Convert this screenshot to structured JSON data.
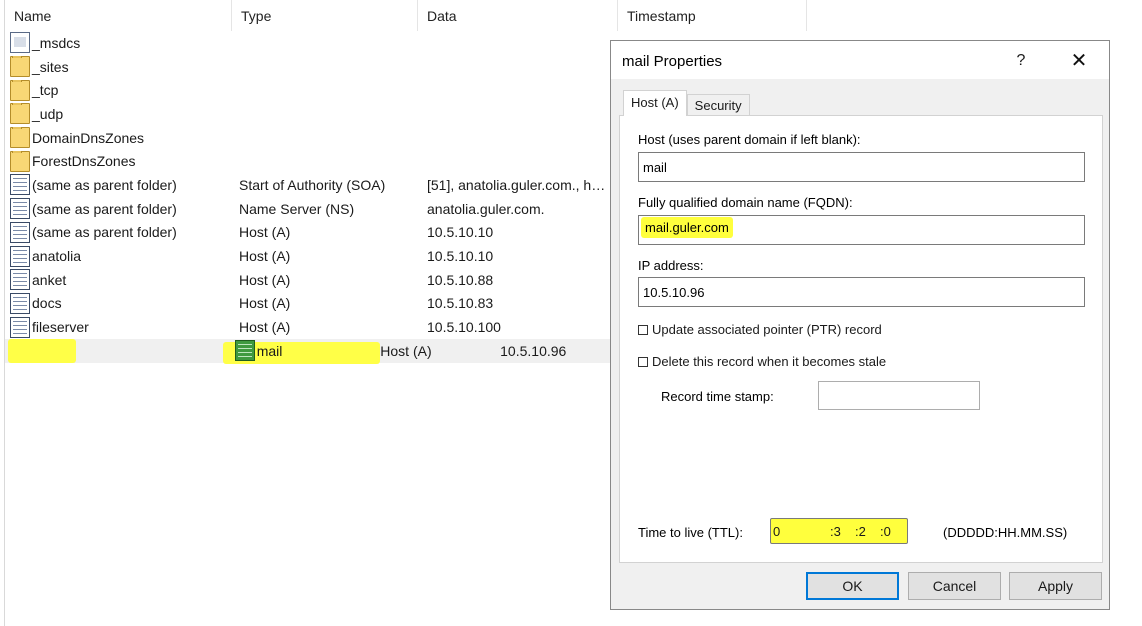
{
  "listview": {
    "columns": {
      "name": "Name",
      "type": "Type",
      "data": "Data",
      "timestamp": "Timestamp"
    },
    "rows": [
      {
        "name": "_msdcs",
        "type": "",
        "data": "",
        "icon": "zone-icon"
      },
      {
        "name": "_sites",
        "type": "",
        "data": "",
        "icon": "folder-icon"
      },
      {
        "name": "_tcp",
        "type": "",
        "data": "",
        "icon": "folder-icon"
      },
      {
        "name": "_udp",
        "type": "",
        "data": "",
        "icon": "folder-icon"
      },
      {
        "name": "DomainDnsZones",
        "type": "",
        "data": "",
        "icon": "folder-icon"
      },
      {
        "name": "ForestDnsZones",
        "type": "",
        "data": "",
        "icon": "folder-icon"
      },
      {
        "name": "(same as parent folder)",
        "type": "Start of Authority (SOA)",
        "data": "[51], anatolia.guler.com., ho...",
        "icon": "record-icon"
      },
      {
        "name": "(same as parent folder)",
        "type": "Name Server (NS)",
        "data": "anatolia.guler.com.",
        "icon": "record-icon"
      },
      {
        "name": "(same as parent folder)",
        "type": "Host (A)",
        "data": "10.5.10.10",
        "icon": "record-icon"
      },
      {
        "name": "anatolia",
        "type": "Host (A)",
        "data": "10.5.10.10",
        "icon": "record-icon"
      },
      {
        "name": "anket",
        "type": "Host (A)",
        "data": "10.5.10.88",
        "icon": "record-icon"
      },
      {
        "name": "docs",
        "type": "Host (A)",
        "data": "10.5.10.83",
        "icon": "record-icon"
      },
      {
        "name": "fileserver",
        "type": "Host (A)",
        "data": "10.5.10.100",
        "icon": "record-icon"
      },
      {
        "name": "mail",
        "type": "Host (A)",
        "data": "10.5.10.96",
        "icon": "record-icon",
        "selected": true
      }
    ]
  },
  "dialog": {
    "title": "mail Properties",
    "help_label": "?",
    "close_label": "✕",
    "tabs": [
      {
        "label": "Host (A)",
        "active": true
      },
      {
        "label": "Security",
        "active": false
      }
    ],
    "host_label": "Host (uses parent domain if left blank):",
    "host_value": "mail",
    "fqdn_label": "Fully qualified domain name (FQDN):",
    "fqdn_value": "mail.guler.com",
    "ip_label": "IP address:",
    "ip_value": "10.5.10.96",
    "update_ptr_label": "Update associated pointer (PTR) record",
    "update_ptr_checked": false,
    "delete_stale_label": "Delete this record when it becomes stale",
    "delete_stale_checked": false,
    "record_timestamp_label": "Record time stamp:",
    "record_timestamp_value": "",
    "ttl_label": "Time to live (TTL):",
    "ttl_days": "0",
    "ttl_hours": ":3",
    "ttl_minutes": ":2",
    "ttl_seconds": ":0",
    "ttl_format": "(DDDDD:HH.MM.SS)",
    "ok_label": "OK",
    "cancel_label": "Cancel",
    "apply_label": "Apply"
  },
  "colors": {
    "highlight": "#ffff3d",
    "selected_row": "#f0f0f0",
    "focus_border": "#0078d7"
  }
}
